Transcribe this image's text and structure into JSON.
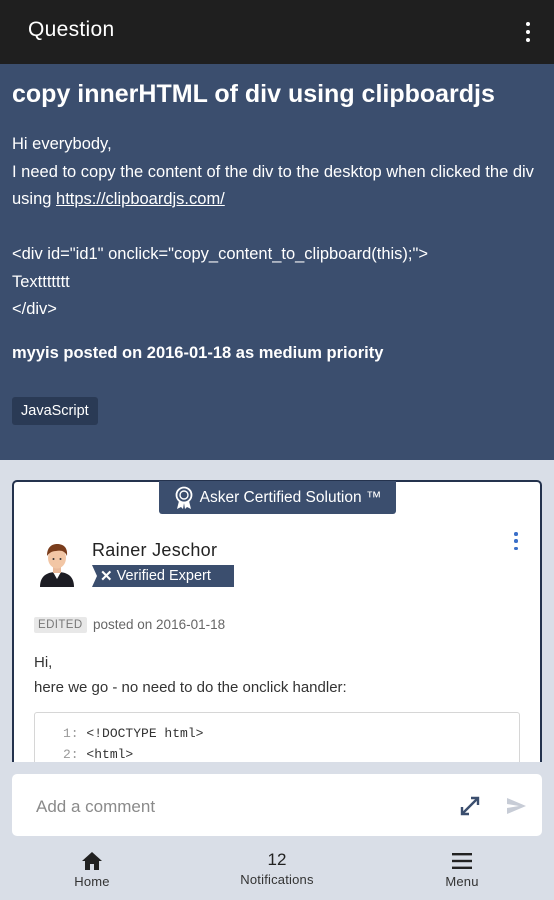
{
  "appbar": {
    "title": "Question"
  },
  "question": {
    "title": "copy innerHTML of div using clipboardjs",
    "body": {
      "line1": "Hi everybody,",
      "line2": "I need to copy the content of the div to the desktop when clicked the div using ",
      "link": "https://clipboardjs.com/",
      "code1": "<div id=\"id1\" onclick=\"copy_content_to_clipboard(this);\">",
      "code2": "Texttttttt",
      "code3": "</div>"
    },
    "meta": "myyis posted on 2016-01-18 as medium priority",
    "tag": "JavaScript"
  },
  "answer": {
    "badge": "Asker Certified Solution ™",
    "author": "Rainer Jeschor",
    "expert_label": "Verified Expert",
    "edited_label": "EDITED",
    "posted": "posted on 2016-01-18",
    "body_line1": "Hi,",
    "body_line2": "here we go - no need to do the onclick handler:",
    "code": [
      {
        "num": "1:",
        "text": "<!DOCTYPE html>"
      },
      {
        "num": "2:",
        "text": "<html>"
      }
    ]
  },
  "comment": {
    "placeholder": "Add a comment"
  },
  "nav": {
    "home": "Home",
    "notifications_count": "12",
    "notifications": "Notifications",
    "menu": "Menu"
  },
  "colors": {
    "appbar": "#1f1f1f",
    "question_bg": "#3b4e6e",
    "tag_bg": "#2a3a55",
    "page_bg": "#d9dee7",
    "accent": "#3a6fc9"
  },
  "icons": [
    "more-vert-icon",
    "certified-ribbon-icon",
    "expert-x-icon",
    "expand-icon",
    "send-icon",
    "home-icon",
    "menu-icon"
  ]
}
